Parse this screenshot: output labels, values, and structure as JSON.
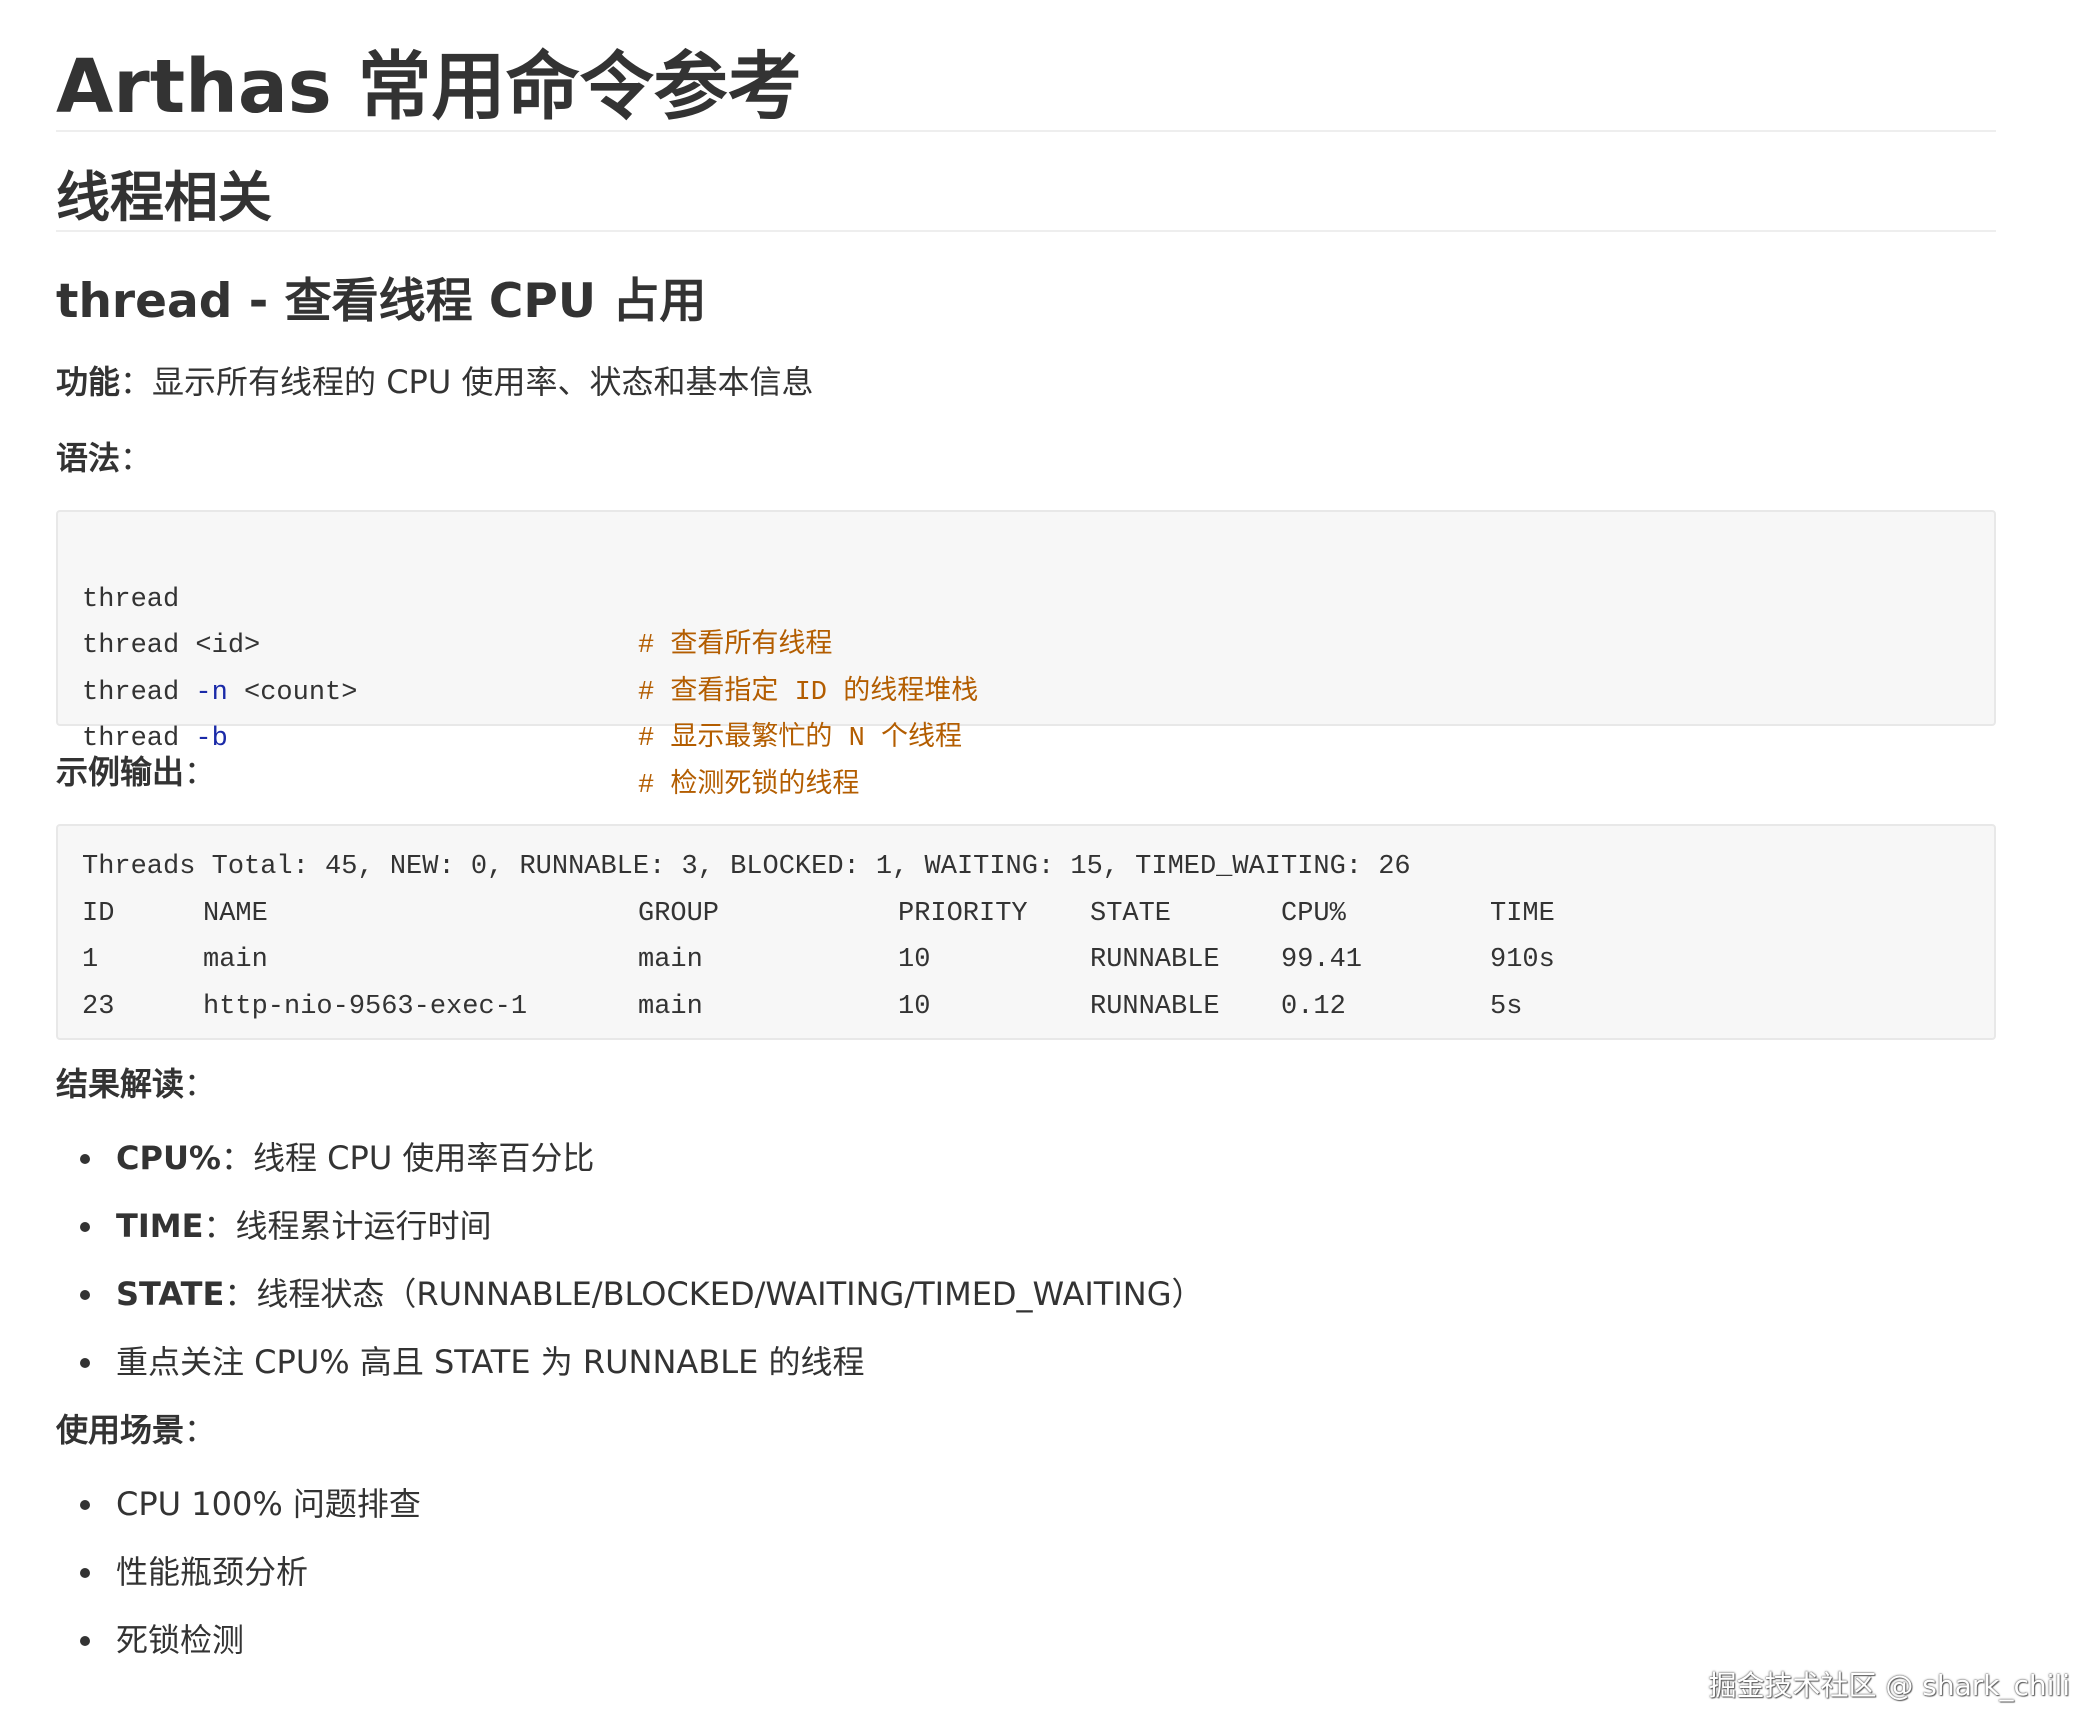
{
  "doc": {
    "title": "Arthas 常用命令参考",
    "section": "线程相关",
    "subsection": "thread - 查看线程 CPU 占用",
    "feature": {
      "label": "功能",
      "sep": "：",
      "text": "显示所有线程的 CPU 使用率、状态和基本信息"
    },
    "syntax": {
      "label": "语法",
      "sep": "："
    },
    "syntax_lines": [
      {
        "cmd": "thread",
        "arg": "",
        "comment": "# 查看所有线程"
      },
      {
        "cmd": "thread <id>",
        "arg": "",
        "comment": "# 查看指定 ID 的线程堆栈"
      },
      {
        "cmd": "thread ",
        "flag": "-n",
        "arg": " <count>",
        "comment": "# 显示最繁忙的 N 个线程"
      },
      {
        "cmd": "thread ",
        "flag": "-b",
        "arg": "",
        "comment": "# 检测死锁的线程"
      }
    ],
    "example": {
      "label": "示例输出",
      "sep": "："
    },
    "example_summary": "Threads Total: 45, NEW: 0, RUNNABLE: 3, BLOCKED: 1, WAITING: 15, TIMED_WAITING: 26",
    "example_columns": [
      "ID",
      "NAME",
      "GROUP",
      "PRIORITY",
      "STATE",
      "CPU%",
      "TIME"
    ],
    "example_rows": [
      [
        "1",
        "main",
        "main",
        "10",
        "RUNNABLE",
        "99.41",
        "910s"
      ],
      [
        "23",
        "http-nio-9563-exec-1",
        "main",
        "10",
        "RUNNABLE",
        "0.12",
        "5s"
      ]
    ],
    "interpretation": {
      "label": "结果解读",
      "sep": "："
    },
    "interpretation_items": [
      {
        "bold": "CPU%",
        "sep": "：",
        "text": "线程 CPU 使用率百分比"
      },
      {
        "bold": "TIME",
        "sep": "：",
        "text": "线程累计运行时间"
      },
      {
        "bold": "STATE",
        "sep": "：",
        "text": "线程状态（RUNNABLE/BLOCKED/WAITING/TIMED_WAITING）"
      },
      {
        "bold": "",
        "sep": "",
        "text": "重点关注 CPU% 高且 STATE 为 RUNNABLE 的线程"
      }
    ],
    "usage": {
      "label": "使用场景",
      "sep": "："
    },
    "usage_items": [
      "CPU 100% 问题排查",
      "性能瓶颈分析",
      "死锁检测"
    ]
  },
  "watermark": "掘金技术社区 @ shark_chili",
  "colors": {
    "comment": "#b35d00",
    "flag": "#1a2aa8",
    "code_bg": "#f7f7f7",
    "text": "#333333"
  }
}
